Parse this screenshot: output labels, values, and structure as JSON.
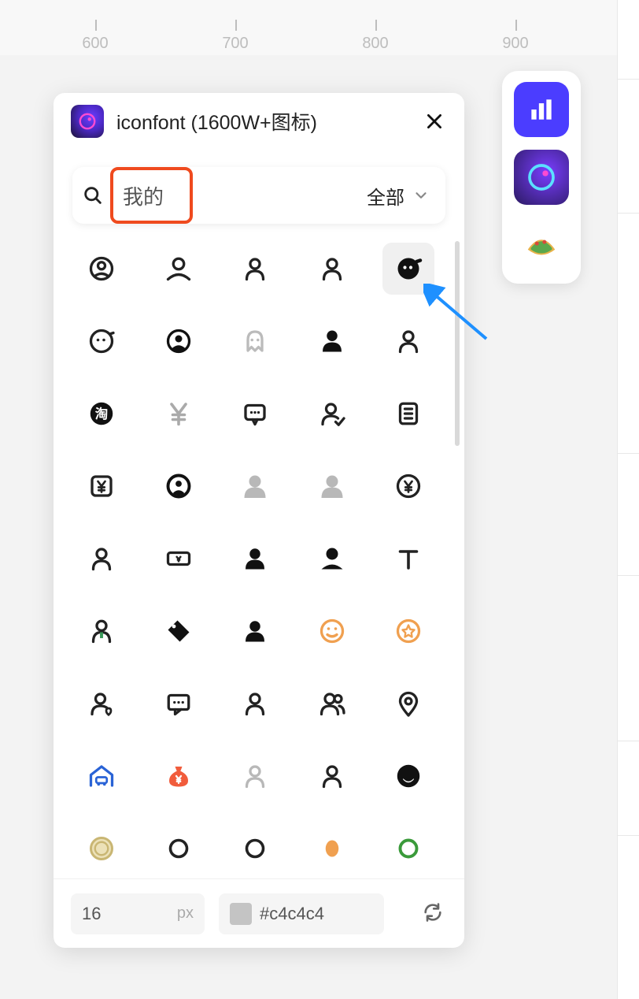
{
  "ruler": {
    "ticks": [
      600,
      700,
      800,
      900
    ]
  },
  "panel": {
    "title": "iconfont (1600W+图标)",
    "search_value": "我的",
    "filter_label": "全部"
  },
  "footer": {
    "size_value": "16",
    "size_unit": "px",
    "color_hex": "#c4c4c4"
  },
  "icons": [
    {
      "name": "user-circle-o",
      "kind": "user_circle_o"
    },
    {
      "name": "user-outline-wide",
      "kind": "user_out_wide"
    },
    {
      "name": "user-outline",
      "kind": "user_out"
    },
    {
      "name": "user-outline-2",
      "kind": "user_out2"
    },
    {
      "name": "face-chat-solid",
      "kind": "face_chat_solid",
      "hover": true
    },
    {
      "name": "face-chat-outline",
      "kind": "face_chat_o"
    },
    {
      "name": "user-circle-solid",
      "kind": "user_circle_solid"
    },
    {
      "name": "ghost",
      "kind": "ghost"
    },
    {
      "name": "user-profile-solid",
      "kind": "user_profile_solid"
    },
    {
      "name": "user-outline-thin",
      "kind": "user_out_thin"
    },
    {
      "name": "taobao-bubble",
      "kind": "tao"
    },
    {
      "name": "yen",
      "kind": "yen"
    },
    {
      "name": "chat-bubble",
      "kind": "chat_o"
    },
    {
      "name": "user-check",
      "kind": "user_check"
    },
    {
      "name": "list-doc",
      "kind": "list_doc"
    },
    {
      "name": "yen-card",
      "kind": "yen_card"
    },
    {
      "name": "user-ring",
      "kind": "user_ring"
    },
    {
      "name": "head-grey",
      "kind": "head_grey"
    },
    {
      "name": "head-grey-2",
      "kind": "head_grey2"
    },
    {
      "name": "yen-circle",
      "kind": "yen_circle"
    },
    {
      "name": "user-outline-3",
      "kind": "user_out3"
    },
    {
      "name": "ticket-yen",
      "kind": "ticket"
    },
    {
      "name": "user-solid",
      "kind": "user_solid"
    },
    {
      "name": "user-solid-flat",
      "kind": "user_solid_flat"
    },
    {
      "name": "text-T",
      "kind": "textT"
    },
    {
      "name": "user-tie",
      "kind": "user_tie"
    },
    {
      "name": "tag",
      "kind": "tag"
    },
    {
      "name": "user-solid-2",
      "kind": "user_solid2"
    },
    {
      "name": "smile-orange",
      "kind": "smile_o",
      "color": "#f0a050"
    },
    {
      "name": "star-circle-orange",
      "kind": "star_circle",
      "color": "#f0a050"
    },
    {
      "name": "user-heart",
      "kind": "user_heart"
    },
    {
      "name": "comment-dots",
      "kind": "comment"
    },
    {
      "name": "user-outline-4",
      "kind": "user_out4"
    },
    {
      "name": "users-pair",
      "kind": "users"
    },
    {
      "name": "map-pin",
      "kind": "pin"
    },
    {
      "name": "car-garage",
      "kind": "garage",
      "color": "#2a63d6"
    },
    {
      "name": "money-bag",
      "kind": "moneybag",
      "color": "#f15c3c"
    },
    {
      "name": "user-outline-grey",
      "kind": "user_out_grey",
      "color": "#b8b8b8"
    },
    {
      "name": "user-outline-5",
      "kind": "user_out5"
    },
    {
      "name": "face-circle-solid",
      "kind": "face_circle"
    },
    {
      "name": "coin",
      "kind": "coin",
      "color": "#d9c27a"
    },
    {
      "name": "circle-outline",
      "kind": "circ_o"
    },
    {
      "name": "circle-outline-2",
      "kind": "circ_o2"
    },
    {
      "name": "dot-orange",
      "kind": "dot",
      "color": "#f0a050"
    },
    {
      "name": "circle-green",
      "kind": "circ_green",
      "color": "#3a9a3a"
    }
  ]
}
